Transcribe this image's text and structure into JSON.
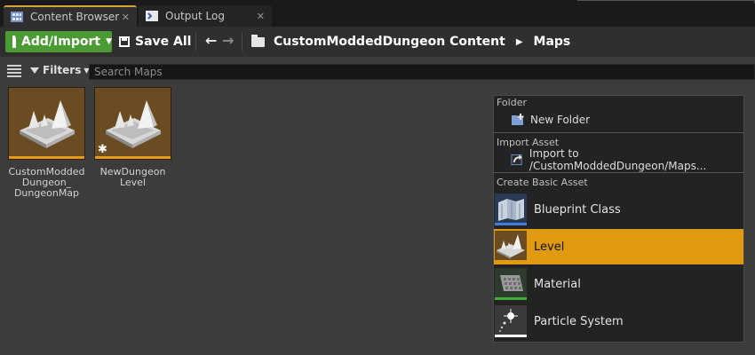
{
  "tabs": [
    {
      "label": "Content Browser",
      "icon": "content-browser-icon",
      "active": true
    },
    {
      "label": "Output Log",
      "icon": "output-log-icon",
      "active": false
    }
  ],
  "toolbar": {
    "add_import_label": "Add/Import",
    "save_all_label": "Save All",
    "breadcrumbs": [
      "CustomModdedDungeon Content",
      "Maps"
    ]
  },
  "filters": {
    "label": "Filters",
    "search_placeholder": "Search Maps"
  },
  "assets": [
    {
      "label": "CustomModded Dungeon_ DungeonMap",
      "icon": "level-map-icon",
      "modified": false
    },
    {
      "label": "NewDungeon Level",
      "icon": "level-map-icon",
      "modified": true
    }
  ],
  "context_menu": {
    "folder_section": "Folder",
    "new_folder": "New Folder",
    "import_section": "Import Asset",
    "import_to": "Import to /CustomModdedDungeon/Maps...",
    "basic_section": "Create Basic Asset",
    "basic_items": [
      {
        "label": "Blueprint Class",
        "icon": "blueprint-class-icon",
        "accent": "#3f7de0"
      },
      {
        "label": "Level",
        "icon": "level-icon",
        "accent": "#e09a12",
        "selected": true
      },
      {
        "label": "Material",
        "icon": "material-icon",
        "accent": "#3fae3a"
      },
      {
        "label": "Particle System",
        "icon": "particle-system-icon",
        "accent": "#ffffff"
      }
    ]
  },
  "colors": {
    "accent_green": "#4c9a34",
    "selection_orange": "#e09a12",
    "level_thumb_bg": "#6b4b22"
  }
}
